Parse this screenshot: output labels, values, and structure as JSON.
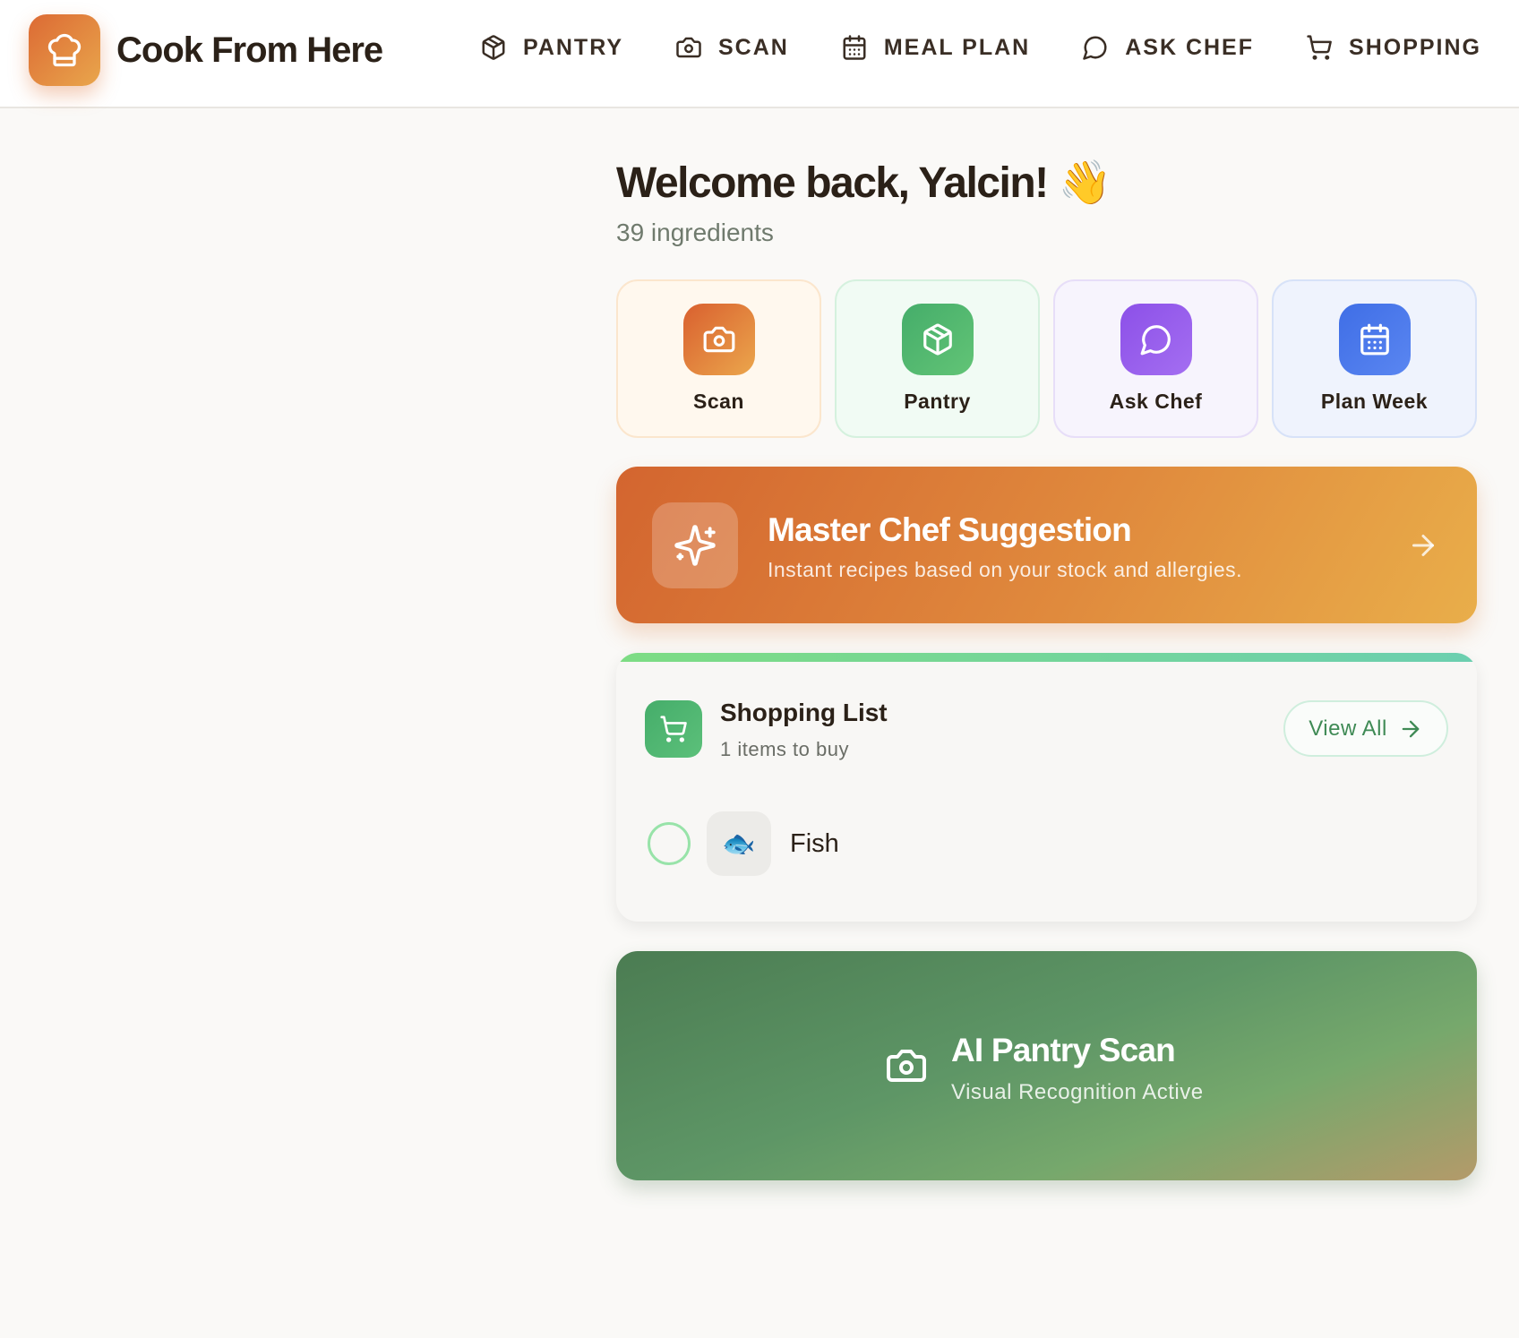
{
  "app": {
    "name": "Cook From Here",
    "logo_icon": "chef-hat-icon",
    "accent_color": "#e07a3a"
  },
  "nav": [
    {
      "label": "PANTRY",
      "icon": "package-icon"
    },
    {
      "label": "SCAN",
      "icon": "camera-icon"
    },
    {
      "label": "MEAL PLAN",
      "icon": "calendar-icon"
    },
    {
      "label": "ASK CHEF",
      "icon": "chat-bubble-icon"
    },
    {
      "label": "SHOPPING",
      "icon": "cart-icon"
    }
  ],
  "welcome": {
    "title": "Welcome back, Yalcin! 👋",
    "subtitle": "39 ingredients"
  },
  "quick_actions": [
    {
      "label": "Scan",
      "icon": "camera-icon",
      "color": "#e07a3a"
    },
    {
      "label": "Pantry",
      "icon": "package-icon",
      "color": "#4fb46e"
    },
    {
      "label": "Ask Chef",
      "icon": "chat-bubble-icon",
      "color": "#9a5eee"
    },
    {
      "label": "Plan Week",
      "icon": "calendar-icon",
      "color": "#4a78eb"
    }
  ],
  "suggestion": {
    "title": "Master Chef Suggestion",
    "subtitle": "Instant recipes based on your stock and allergies.",
    "icon": "sparkles-icon"
  },
  "shopping": {
    "title": "Shopping List",
    "count_text": "1 items to buy",
    "view_all_label": "View All",
    "items": [
      {
        "name": "Fish",
        "emoji": "🐟",
        "checked": false
      }
    ]
  },
  "ai_scan": {
    "title": "AI Pantry Scan",
    "subtitle": "Visual Recognition Active",
    "icon": "camera-icon"
  }
}
